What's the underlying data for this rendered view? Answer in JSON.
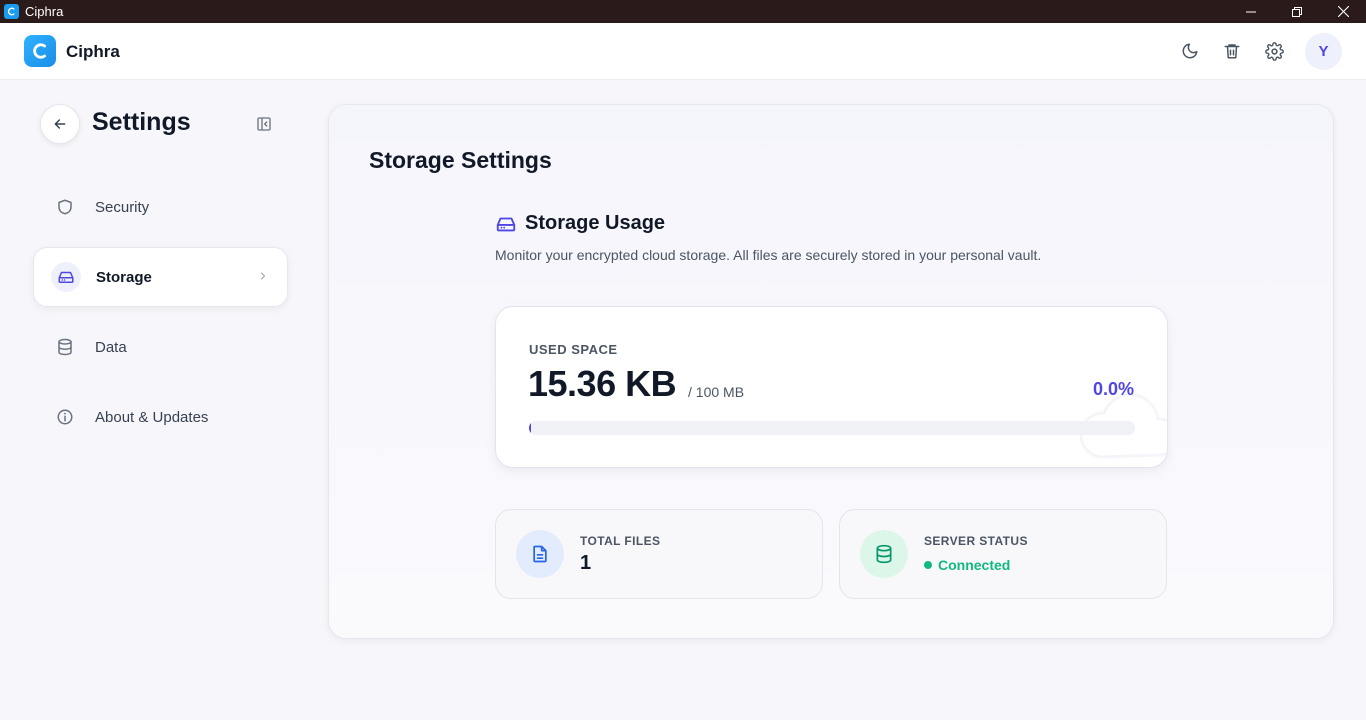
{
  "window": {
    "title": "Ciphra"
  },
  "header": {
    "brand": "Ciphra",
    "avatar_initial": "Y"
  },
  "sidebar": {
    "title": "Settings",
    "items": [
      {
        "label": "Security",
        "icon": "shield-icon"
      },
      {
        "label": "Storage",
        "icon": "hard-drive-icon",
        "active": true
      },
      {
        "label": "Data",
        "icon": "database-icon"
      },
      {
        "label": "About & Updates",
        "icon": "info-icon"
      }
    ]
  },
  "main": {
    "title": "Storage Settings",
    "section": {
      "title": "Storage Usage",
      "description": "Monitor your encrypted cloud storage. All files are securely stored in your personal vault."
    },
    "usage": {
      "label": "USED SPACE",
      "value": "15.36 KB",
      "total": "/ 100 MB",
      "percent_text": "0.0%",
      "fill_fraction": 0.0
    },
    "stats": {
      "files": {
        "label": "TOTAL FILES",
        "value": "1"
      },
      "server": {
        "label": "SERVER STATUS",
        "value": "Connected"
      }
    }
  },
  "colors": {
    "accent": "#4f46e5",
    "success": "#10b981",
    "titlebar": "#2b1a1a",
    "brand": "#1a9cf0"
  }
}
